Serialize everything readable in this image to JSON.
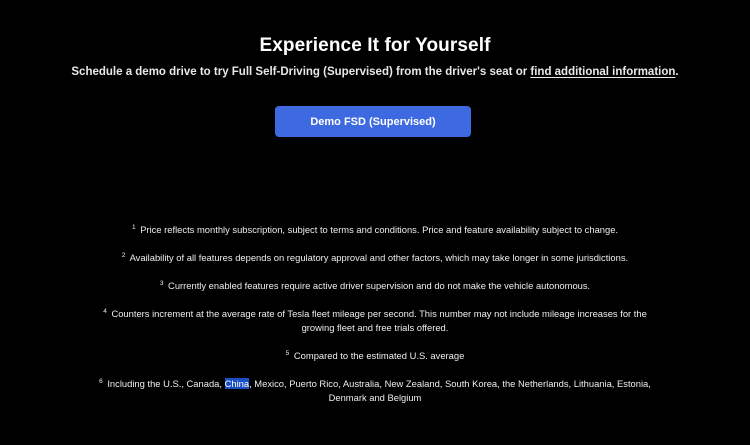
{
  "hero": {
    "title": "Experience It for Yourself",
    "subtitle_prefix": "Schedule a demo drive to try Full Self-Driving (Supervised) from the driver's seat or ",
    "subtitle_link": "find additional information",
    "subtitle_suffix": ".",
    "button_label": "Demo FSD (Supervised)"
  },
  "colors": {
    "background": "#000000",
    "button": "#3e6ae1",
    "text_selection_highlight": "#1a4fc4"
  },
  "footnotes": [
    {
      "num": "1",
      "text": "Price reflects monthly subscription, subject to terms and conditions. Price and feature availability subject to change."
    },
    {
      "num": "2",
      "text": "Availability of all features depends on regulatory approval and other factors, which may take longer in some jurisdictions."
    },
    {
      "num": "3",
      "text": "Currently enabled features require active driver supervision and do not make the vehicle autonomous."
    },
    {
      "num": "4",
      "text": "Counters increment at the average rate of Tesla fleet mileage per second. This number may not include mileage increases for the growing fleet and free trials offered."
    },
    {
      "num": "5",
      "text": "Compared to the estimated U.S. average"
    },
    {
      "num": "6",
      "text_before": "Including the U.S., Canada, ",
      "text_highlight": "China",
      "text_after": ", Mexico, Puerto Rico, Australia, New Zealand, South Korea, the Netherlands, Lithuania, Estonia, Denmark and Belgium"
    }
  ]
}
